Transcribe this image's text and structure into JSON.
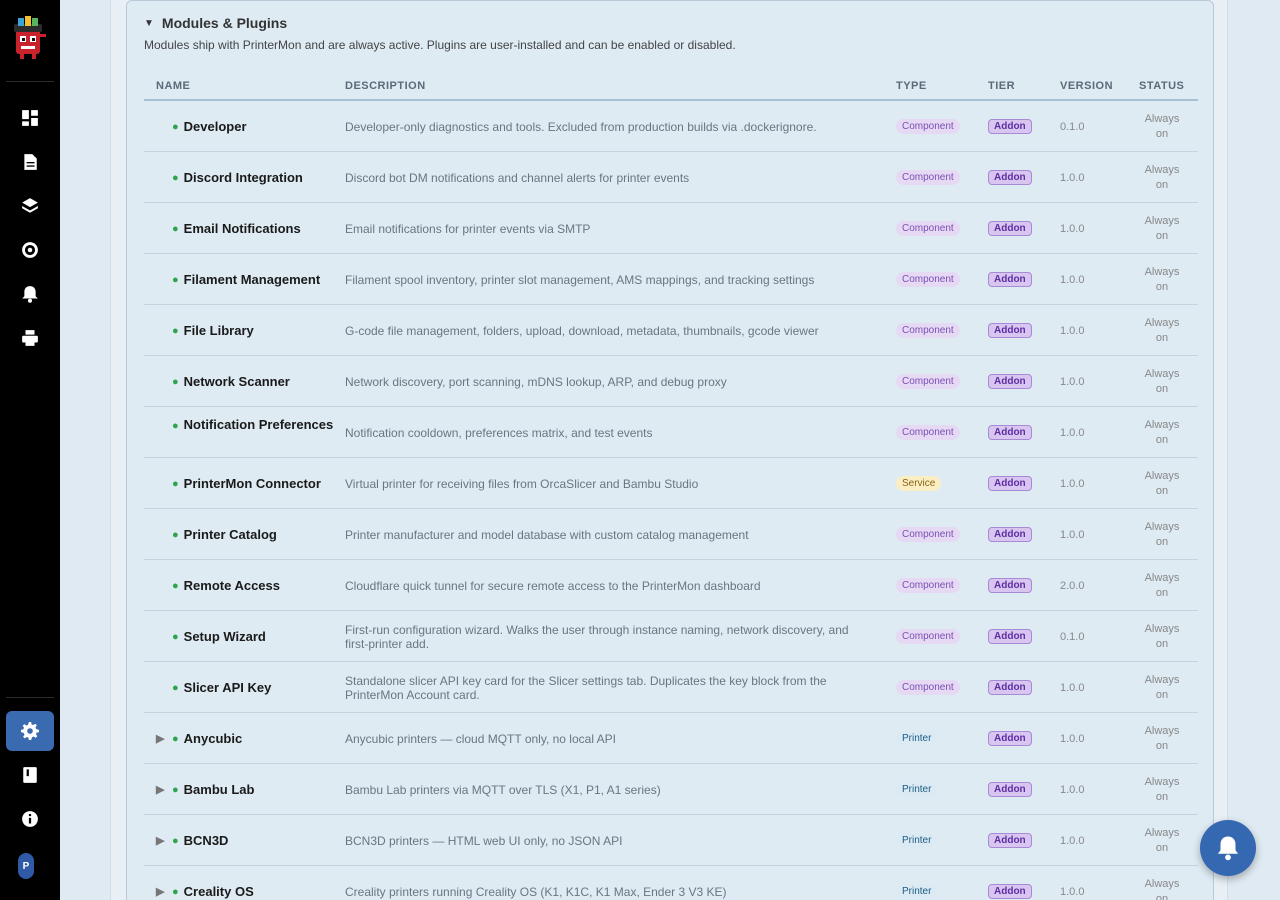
{
  "sidebar": {
    "avatar_initial": "P",
    "items": [
      {
        "icon": "dashboard-icon"
      },
      {
        "icon": "document-icon"
      },
      {
        "icon": "layers-icon"
      },
      {
        "icon": "target-icon"
      },
      {
        "icon": "bell-icon"
      },
      {
        "icon": "printer-icon"
      },
      {
        "icon": "gear-icon",
        "active": true
      },
      {
        "icon": "book-icon"
      },
      {
        "icon": "info-icon"
      }
    ]
  },
  "section": {
    "title": "Modules & Plugins",
    "subtitle": "Modules ship with PrinterMon and are always active. Plugins are user-installed and can be enabled or disabled."
  },
  "table": {
    "headers": {
      "name": "NAME",
      "description": "DESCRIPTION",
      "type": "TYPE",
      "tier": "TIER",
      "version": "VERSION",
      "status": "STATUS"
    },
    "rows": [
      {
        "name": "Developer",
        "description": "Developer-only diagnostics and tools. Excluded from production builds via .dockerignore.",
        "type": "Component",
        "tier": "Addon",
        "version": "0.1.0",
        "status_l1": "Always",
        "status_l2": "on"
      },
      {
        "name": "Discord Integration",
        "description": "Discord bot DM notifications and channel alerts for printer events",
        "type": "Component",
        "tier": "Addon",
        "version": "1.0.0",
        "status_l1": "Always",
        "status_l2": "on"
      },
      {
        "name": "Email Notifications",
        "description": "Email notifications for printer events via SMTP",
        "type": "Component",
        "tier": "Addon",
        "version": "1.0.0",
        "status_l1": "Always",
        "status_l2": "on"
      },
      {
        "name": "Filament Management",
        "description": "Filament spool inventory, printer slot management, AMS mappings, and tracking settings",
        "type": "Component",
        "tier": "Addon",
        "version": "1.0.0",
        "status_l1": "Always",
        "status_l2": "on"
      },
      {
        "name": "File Library",
        "description": "G-code file management, folders, upload, download, metadata, thumbnails, gcode viewer",
        "type": "Component",
        "tier": "Addon",
        "version": "1.0.0",
        "status_l1": "Always",
        "status_l2": "on"
      },
      {
        "name": "Network Scanner",
        "description": "Network discovery, port scanning, mDNS lookup, ARP, and debug proxy",
        "type": "Component",
        "tier": "Addon",
        "version": "1.0.0",
        "status_l1": "Always",
        "status_l2": "on"
      },
      {
        "name": "Notification Preferences",
        "description": "Notification cooldown, preferences matrix, and test events",
        "type": "Component",
        "tier": "Addon",
        "version": "1.0.0",
        "status_l1": "Always",
        "status_l2": "on"
      },
      {
        "name": "PrinterMon Connector",
        "description": "Virtual printer for receiving files from OrcaSlicer and Bambu Studio",
        "type": "Service",
        "tier": "Addon",
        "version": "1.0.0",
        "status_l1": "Always",
        "status_l2": "on"
      },
      {
        "name": "Printer Catalog",
        "description": "Printer manufacturer and model database with custom catalog management",
        "type": "Component",
        "tier": "Addon",
        "version": "1.0.0",
        "status_l1": "Always",
        "status_l2": "on"
      },
      {
        "name": "Remote Access",
        "description": "Cloudflare quick tunnel for secure remote access to the PrinterMon dashboard",
        "type": "Component",
        "tier": "Addon",
        "version": "2.0.0",
        "status_l1": "Always",
        "status_l2": "on"
      },
      {
        "name": "Setup Wizard",
        "description": "First-run configuration wizard. Walks the user through instance naming, network discovery, and first-printer add.",
        "type": "Component",
        "tier": "Addon",
        "version": "0.1.0",
        "status_l1": "Always",
        "status_l2": "on"
      },
      {
        "name": "Slicer API Key",
        "description": "Standalone slicer API key card for the Slicer settings tab. Duplicates the key block from the PrinterMon Account card.",
        "type": "Component",
        "tier": "Addon",
        "version": "1.0.0",
        "status_l1": "Always",
        "status_l2": "on"
      },
      {
        "name": "Anycubic",
        "description": "Anycubic printers — cloud MQTT only, no local API",
        "type": "Printer",
        "tier": "Addon",
        "version": "1.0.0",
        "status_l1": "Always",
        "status_l2": "on",
        "expandable": true
      },
      {
        "name": "Bambu Lab",
        "description": "Bambu Lab printers via MQTT over TLS (X1, P1, A1 series)",
        "type": "Printer",
        "tier": "Addon",
        "version": "1.0.0",
        "status_l1": "Always",
        "status_l2": "on",
        "expandable": true
      },
      {
        "name": "BCN3D",
        "description": "BCN3D printers — HTML web UI only, no JSON API",
        "type": "Printer",
        "tier": "Addon",
        "version": "1.0.0",
        "status_l1": "Always",
        "status_l2": "on",
        "expandable": true
      },
      {
        "name": "Creality OS",
        "description": "Creality printers running Creality OS (K1, K1C, K1 Max, Ender 3 V3 KE)",
        "type": "Printer",
        "tier": "Addon",
        "version": "1.0.0",
        "status_l1": "Always",
        "status_l2": "on",
        "expandable": true
      }
    ]
  }
}
